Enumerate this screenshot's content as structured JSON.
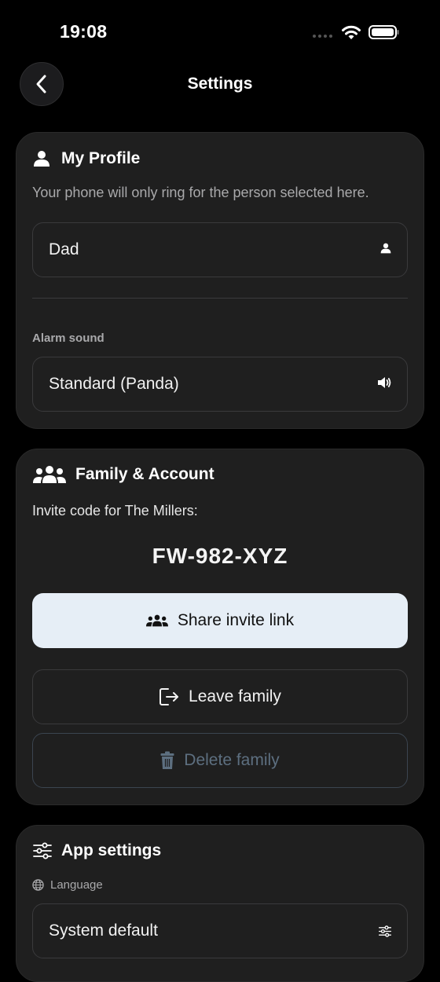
{
  "status_bar": {
    "time": "19:08"
  },
  "nav": {
    "back_icon": "chevron-left-icon",
    "title": "Settings"
  },
  "profile": {
    "title": "My Profile",
    "icon": "person-icon",
    "description": "Your phone will only ring for the person selected here.",
    "person_value": "Dad",
    "person_icon": "person-icon",
    "alarm_label": "Alarm sound",
    "alarm_value": "Standard (Panda)",
    "alarm_icon": "speaker-icon"
  },
  "family": {
    "title": "Family & Account",
    "icon": "group-icon",
    "invite_text": "Invite code for The Millers:",
    "invite_code": "FW-982-XYZ",
    "share_label": "Share invite link",
    "share_icon": "group-icon",
    "leave_label": "Leave family",
    "leave_icon": "logout-icon",
    "delete_label": "Delete family",
    "delete_icon": "trash-icon"
  },
  "app_settings": {
    "title": "App settings",
    "icon": "sliders-icon",
    "language_label": "Language",
    "language_icon": "globe-icon",
    "language_value": "System default",
    "language_value_icon": "sliders-icon"
  },
  "colors": {
    "background": "#000000",
    "card": "#1f1f1f",
    "share_button": "#e6eef6",
    "delete_text": "#5d6f80"
  }
}
